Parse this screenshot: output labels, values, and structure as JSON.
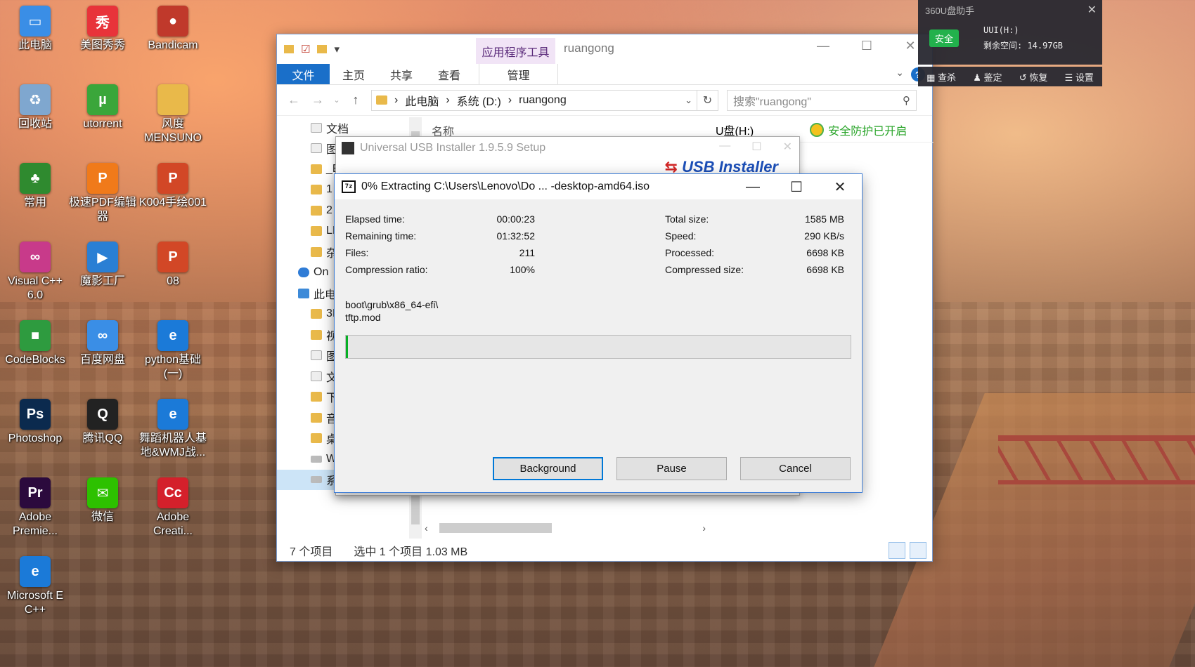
{
  "desktop": {
    "icons": [
      {
        "label": "此电脑",
        "icon": "this-pc-icon",
        "color": "#3a8ee6",
        "glyph": "▭"
      },
      {
        "label": "美图秀秀",
        "icon": "meitu-icon",
        "color": "#e8333a",
        "glyph": "秀"
      },
      {
        "label": "Bandicam",
        "icon": "bandicam-icon",
        "color": "#c0392b",
        "glyph": "●"
      },
      {
        "label": "回收站",
        "icon": "recycle-bin-icon",
        "color": "#7fa7cf",
        "glyph": "♻"
      },
      {
        "label": "utorrent",
        "icon": "utorrent-icon",
        "color": "#3aa63a",
        "glyph": "µ"
      },
      {
        "label": "风度\nMENSUNO",
        "icon": "folder-icon",
        "color": "#e9b94a",
        "glyph": ""
      },
      {
        "label": "常用",
        "icon": "tree-folder-icon",
        "color": "#2f8a2f",
        "glyph": "♣"
      },
      {
        "label": "极速PDF编辑器",
        "icon": "pdf-editor-icon",
        "color": "#f07a1a",
        "glyph": "P"
      },
      {
        "label": "K004手绘001",
        "icon": "ppt-file-icon",
        "color": "#d24726",
        "glyph": "P"
      },
      {
        "label": "Visual C++\n6.0",
        "icon": "visual-cpp-icon",
        "color": "#c83a8a",
        "glyph": "∞"
      },
      {
        "label": "魔影工厂",
        "icon": "moying-icon",
        "color": "#2a7fd4",
        "glyph": "▶"
      },
      {
        "label": "08",
        "icon": "ppt-file-icon",
        "color": "#d24726",
        "glyph": "P"
      },
      {
        "label": "CodeBlocks",
        "icon": "codeblocks-icon",
        "color": "#2e9b3f",
        "glyph": "■"
      },
      {
        "label": "百度网盘",
        "icon": "baidu-netdisk-icon",
        "color": "#3a8ee6",
        "glyph": "∞"
      },
      {
        "label": "python基础\n(一)",
        "icon": "pdf-file-icon",
        "color": "#1b7ad8",
        "glyph": "e"
      },
      {
        "label": "Photoshop",
        "icon": "photoshop-icon",
        "color": "#0b2a4e",
        "glyph": "Ps"
      },
      {
        "label": "腾讯QQ",
        "icon": "qq-icon",
        "color": "#222222",
        "glyph": "Q"
      },
      {
        "label": "舞蹈机器人基地&WMJ战...",
        "icon": "pdf-file-icon",
        "color": "#1b7ad8",
        "glyph": "e"
      },
      {
        "label": "Adobe\nPremie...",
        "icon": "premiere-icon",
        "color": "#2b0a3d",
        "glyph": "Pr"
      },
      {
        "label": "微信",
        "icon": "wechat-icon",
        "color": "#2dc100",
        "glyph": "✉"
      },
      {
        "label": "Adobe\nCreati...",
        "icon": "adobe-cc-icon",
        "color": "#d4202b",
        "glyph": "Cc"
      },
      {
        "label": "Microsoft E\nC++",
        "icon": "edge-icon",
        "color": "#1b7ad8",
        "glyph": "e"
      }
    ]
  },
  "explorer": {
    "context_tab": "应用程序工具",
    "title": "ruangong",
    "ribbon_tabs": [
      "文件",
      "主页",
      "共享",
      "查看",
      "管理"
    ],
    "help_glyph": "?",
    "breadcrumb": [
      "此电脑",
      "系统 (D:)",
      "ruangong"
    ],
    "search_placeholder": "搜索\"ruangong\"",
    "column_name": "名称",
    "nav_items": [
      {
        "label": "文档",
        "kind": "doc"
      },
      {
        "label": "图",
        "kind": "doc"
      },
      {
        "label": "_E",
        "kind": "folder"
      },
      {
        "label": "1",
        "kind": "folder"
      },
      {
        "label": "2",
        "kind": "folder"
      },
      {
        "label": "LI",
        "kind": "folder"
      },
      {
        "label": "杂",
        "kind": "folder"
      },
      {
        "label": "On",
        "kind": "cloud"
      },
      {
        "label": "此电",
        "kind": "pc"
      },
      {
        "label": "3I",
        "kind": "folder"
      },
      {
        "label": "视",
        "kind": "folder"
      },
      {
        "label": "图",
        "kind": "doc"
      },
      {
        "label": "文",
        "kind": "doc"
      },
      {
        "label": "下",
        "kind": "folder"
      },
      {
        "label": "音",
        "kind": "folder"
      },
      {
        "label": "桌",
        "kind": "folder"
      },
      {
        "label": "Windows (C:)",
        "kind": "drv"
      },
      {
        "label": "系统 (D:)",
        "kind": "drv"
      }
    ],
    "udisk_label": "U盘(H:)",
    "udisk_status": "安全防护已开启",
    "status_count": "7 个项目",
    "status_selected": "选中 1 个项目  1.03 MB"
  },
  "uui": {
    "title": "Universal USB Installer 1.9.5.9 Setup",
    "logo": "USB Installer"
  },
  "sevenzip": {
    "title": "0% Extracting C:\\Users\\Lenovo\\Do ... -desktop-amd64.iso",
    "logo_text": "7z",
    "rows": [
      {
        "l1": "Elapsed time:",
        "v1": "00:00:23",
        "l2": "Total size:",
        "v2": "1585 MB"
      },
      {
        "l1": "Remaining time:",
        "v1": "01:32:52",
        "l2": "Speed:",
        "v2": "290 KB/s"
      },
      {
        "l1": "Files:",
        "v1": "211",
        "l2": "Processed:",
        "v2": "6698 KB"
      },
      {
        "l1": "Compression ratio:",
        "v1": "100%",
        "l2": "Compressed size:",
        "v2": "6698 KB"
      }
    ],
    "path_line1": "boot\\grub\\x86_64-efi\\",
    "path_line2": "tftp.mod",
    "progress": 0.004,
    "buttons": {
      "background": "Background",
      "pause": "Pause",
      "cancel": "Cancel"
    }
  },
  "popup360": {
    "title": "360U盘助手",
    "badge": "安全",
    "drive": "UUI(H:)",
    "free": "剩余空间: 14.97GB",
    "actions": [
      "查杀",
      "鉴定",
      "恢复",
      "设置"
    ]
  }
}
